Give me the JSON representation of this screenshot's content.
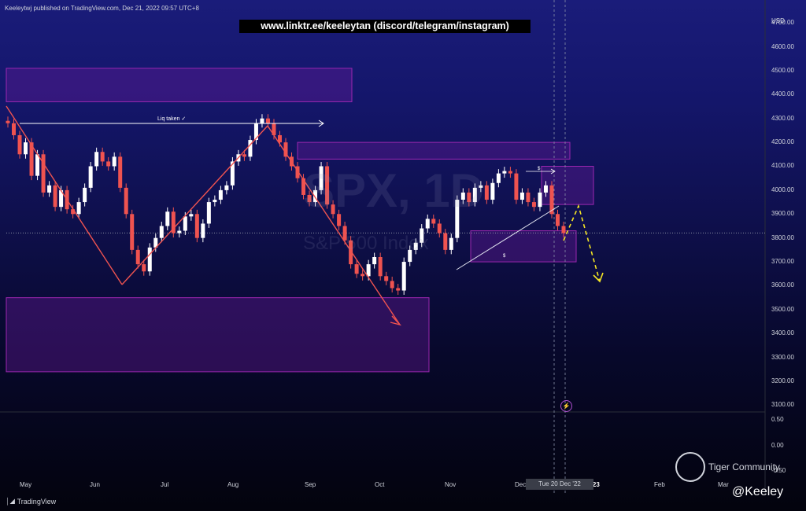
{
  "header": {
    "published": "Keeleytwj published on TradingView.com, Dec 21, 2022 09:57 UTC+8",
    "banner": "www.linktr.ee/keeleytan (discord/telegram/instagram)"
  },
  "watermark": {
    "symbol": "SPX, 1D",
    "name": "S&P 500 Index"
  },
  "annotations": {
    "liq_taken": "Liq taken ✓",
    "s_label_1": "$",
    "s_label_2": "$"
  },
  "footer": {
    "tradingview": "TradingView",
    "tiger": "Tiger Community",
    "handle": "@Keeley"
  },
  "crosshair_date": "Tue 20 Dec '22",
  "colors": {
    "up": "#ffffff",
    "down": "#ef5350",
    "zone_fill": "#6a1b9a",
    "zone_stroke": "#9c27b0",
    "trend": "#ef5350",
    "projection": "#f5e624"
  },
  "chart_data": {
    "type": "candlestick",
    "symbol": "SPX",
    "interval": "1D",
    "y_axis": {
      "unit": "USD",
      "ticks": [
        "4700.00",
        "4600.00",
        "4500.00",
        "4400.00",
        "4300.00",
        "4200.00",
        "4100.00",
        "4000.00",
        "3900.00",
        "3800.00",
        "3700.00",
        "3600.00",
        "3500.00",
        "3400.00",
        "3300.00",
        "3200.00",
        "3100.00"
      ],
      "range": [
        3085,
        4730
      ]
    },
    "x_axis": {
      "ticks": [
        "May",
        "Jun",
        "Jul",
        "Aug",
        "Sep",
        "Oct",
        "Nov",
        "Dec",
        "2023",
        "Feb",
        "Mar"
      ]
    },
    "oscillator_ticks": [
      "0.50",
      "0.00",
      "-0.50"
    ],
    "last_price": 3821,
    "closes": [
      {
        "date": "Apr",
        "close": 4280
      },
      {
        "date": "Apr",
        "close": 4230
      },
      {
        "date": "Apr",
        "close": 4150
      },
      {
        "date": "May",
        "close": 4200
      },
      {
        "date": "May",
        "close": 4060
      },
      {
        "date": "May",
        "close": 4150
      },
      {
        "date": "May",
        "close": 3990
      },
      {
        "date": "May",
        "close": 4020
      },
      {
        "date": "May",
        "close": 3930
      },
      {
        "date": "May",
        "close": 4000
      },
      {
        "date": "May",
        "close": 3920
      },
      {
        "date": "May",
        "close": 3900
      },
      {
        "date": "May",
        "close": 3950
      },
      {
        "date": "May",
        "close": 4010
      },
      {
        "date": "May",
        "close": 4100
      },
      {
        "date": "Jun",
        "close": 4160
      },
      {
        "date": "Jun",
        "close": 4120
      },
      {
        "date": "Jun",
        "close": 4100
      },
      {
        "date": "Jun",
        "close": 4140
      },
      {
        "date": "Jun",
        "close": 4010
      },
      {
        "date": "Jun",
        "close": 3900
      },
      {
        "date": "Jun",
        "close": 3750
      },
      {
        "date": "Jun",
        "close": 3690
      },
      {
        "date": "Jun",
        "close": 3660
      },
      {
        "date": "Jun",
        "close": 3760
      },
      {
        "date": "Jun",
        "close": 3800
      },
      {
        "date": "Jun",
        "close": 3850
      },
      {
        "date": "Jun",
        "close": 3910
      },
      {
        "date": "Jul",
        "close": 3820
      },
      {
        "date": "Jul",
        "close": 3830
      },
      {
        "date": "Jul",
        "close": 3890
      },
      {
        "date": "Jul",
        "close": 3900
      },
      {
        "date": "Jul",
        "close": 3800
      },
      {
        "date": "Jul",
        "close": 3860
      },
      {
        "date": "Jul",
        "close": 3950
      },
      {
        "date": "Jul",
        "close": 3960
      },
      {
        "date": "Jul",
        "close": 4000
      },
      {
        "date": "Jul",
        "close": 4020
      },
      {
        "date": "Aug",
        "close": 4120
      },
      {
        "date": "Aug",
        "close": 4150
      },
      {
        "date": "Aug",
        "close": 4140
      },
      {
        "date": "Aug",
        "close": 4210
      },
      {
        "date": "Aug",
        "close": 4280
      },
      {
        "date": "Aug",
        "close": 4300
      },
      {
        "date": "Aug",
        "close": 4280
      },
      {
        "date": "Aug",
        "close": 4230
      },
      {
        "date": "Aug",
        "close": 4200
      },
      {
        "date": "Aug",
        "close": 4140
      },
      {
        "date": "Sep",
        "close": 4100
      },
      {
        "date": "Sep",
        "close": 4050
      },
      {
        "date": "Sep",
        "close": 3980
      },
      {
        "date": "Sep",
        "close": 3950
      },
      {
        "date": "Sep",
        "close": 4000
      },
      {
        "date": "Sep",
        "close": 4100
      },
      {
        "date": "Sep",
        "close": 3940
      },
      {
        "date": "Sep",
        "close": 3900
      },
      {
        "date": "Sep",
        "close": 3850
      },
      {
        "date": "Sep",
        "close": 3790
      },
      {
        "date": "Sep",
        "close": 3690
      },
      {
        "date": "Sep",
        "close": 3650
      },
      {
        "date": "Oct",
        "close": 3640
      },
      {
        "date": "Oct",
        "close": 3690
      },
      {
        "date": "Oct",
        "close": 3720
      },
      {
        "date": "Oct",
        "close": 3640
      },
      {
        "date": "Oct",
        "close": 3620
      },
      {
        "date": "Oct",
        "close": 3590
      },
      {
        "date": "Oct",
        "close": 3580
      },
      {
        "date": "Oct",
        "close": 3700
      },
      {
        "date": "Oct",
        "close": 3750
      },
      {
        "date": "Oct",
        "close": 3780
      },
      {
        "date": "Oct",
        "close": 3840
      },
      {
        "date": "Oct",
        "close": 3880
      },
      {
        "date": "Nov",
        "close": 3860
      },
      {
        "date": "Nov",
        "close": 3820
      },
      {
        "date": "Nov",
        "close": 3750
      },
      {
        "date": "Nov",
        "close": 3800
      },
      {
        "date": "Nov",
        "close": 3960
      },
      {
        "date": "Nov",
        "close": 3990
      },
      {
        "date": "Nov",
        "close": 3950
      },
      {
        "date": "Nov",
        "close": 4010
      },
      {
        "date": "Nov",
        "close": 4020
      },
      {
        "date": "Nov",
        "close": 3960
      },
      {
        "date": "Nov",
        "close": 4030
      },
      {
        "date": "Nov",
        "close": 4070
      },
      {
        "date": "Dec",
        "close": 4080
      },
      {
        "date": "Dec",
        "close": 4070
      },
      {
        "date": "Dec",
        "close": 3960
      },
      {
        "date": "Dec",
        "close": 3990
      },
      {
        "date": "Dec",
        "close": 3950
      },
      {
        "date": "Dec",
        "close": 3930
      },
      {
        "date": "Dec",
        "close": 3990
      },
      {
        "date": "Dec",
        "close": 4020
      },
      {
        "date": "Dec",
        "close": 3900
      },
      {
        "date": "Dec",
        "close": 3850
      },
      {
        "date": "Dec",
        "close": 3820
      }
    ],
    "zones": [
      {
        "from_date": "Apr",
        "to_date": "Aug",
        "low": 4370,
        "high": 4510
      },
      {
        "from_date": "Aug",
        "to_date": "Dec",
        "low": 4130,
        "high": 4200
      },
      {
        "from_date": "Dec",
        "to_date": "Dec",
        "low": 3940,
        "high": 4100
      },
      {
        "from_date": "Nov",
        "to_date": "Dec",
        "low": 3700,
        "high": 3830
      },
      {
        "from_date": "Apr",
        "to_date": "Oct",
        "low": 3240,
        "high": 3550
      }
    ]
  }
}
